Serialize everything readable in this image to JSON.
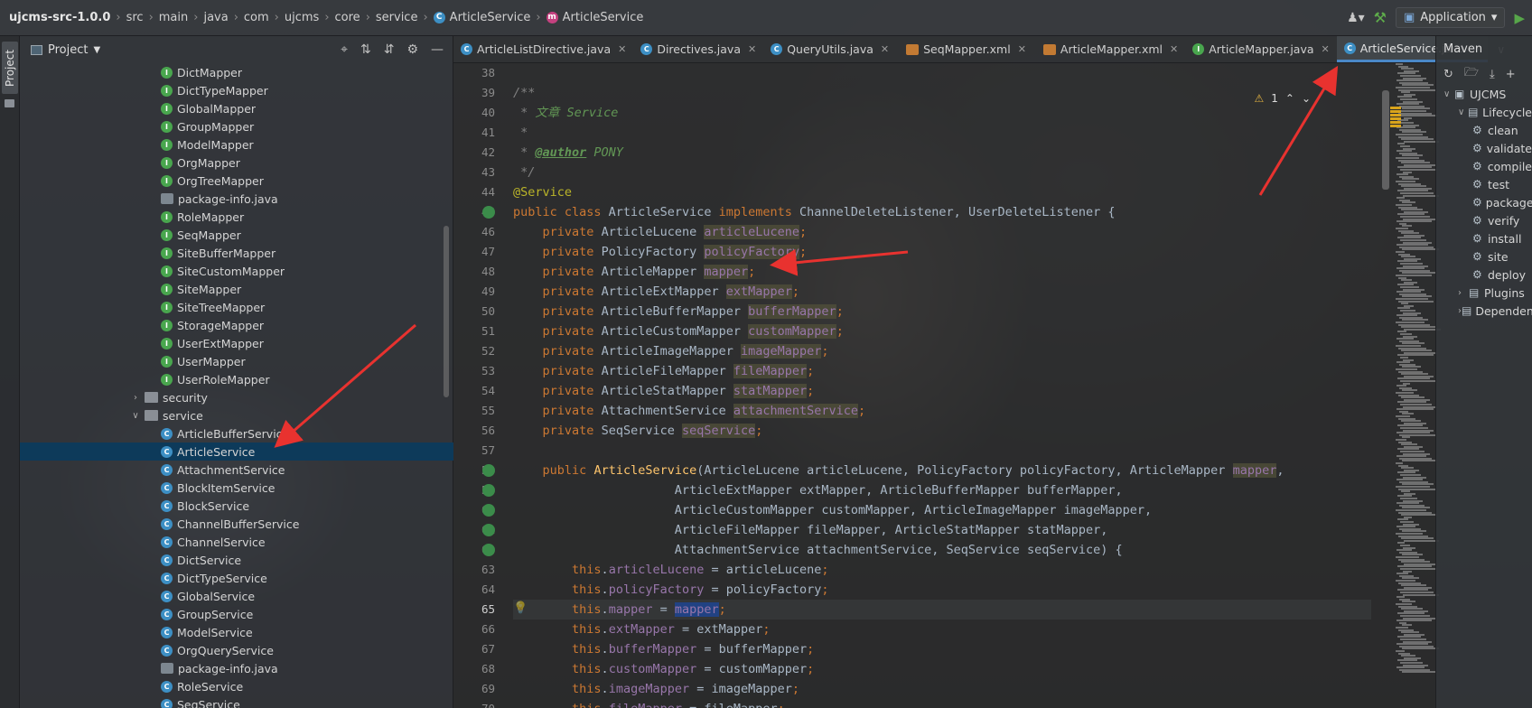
{
  "breadcrumb": [
    {
      "label": "ujcms-src-1.0.0",
      "icon": ""
    },
    {
      "label": "src",
      "icon": ""
    },
    {
      "label": "main",
      "icon": ""
    },
    {
      "label": "java",
      "icon": ""
    },
    {
      "label": "com",
      "icon": ""
    },
    {
      "label": "ujcms",
      "icon": ""
    },
    {
      "label": "core",
      "icon": ""
    },
    {
      "label": "service",
      "icon": ""
    },
    {
      "label": "ArticleService",
      "icon": "class-icon"
    },
    {
      "label": "ArticleService",
      "icon": "method-icon"
    }
  ],
  "toolbar": {
    "run_config": "Application"
  },
  "left_stripe": {
    "project_tab": "Project"
  },
  "project": {
    "title": "Project",
    "tree": [
      {
        "label": "DictMapper",
        "type": "interface",
        "indent": 156
      },
      {
        "label": "DictTypeMapper",
        "type": "interface",
        "indent": 156
      },
      {
        "label": "GlobalMapper",
        "type": "interface",
        "indent": 156
      },
      {
        "label": "GroupMapper",
        "type": "interface",
        "indent": 156
      },
      {
        "label": "ModelMapper",
        "type": "interface",
        "indent": 156
      },
      {
        "label": "OrgMapper",
        "type": "interface",
        "indent": 156
      },
      {
        "label": "OrgTreeMapper",
        "type": "interface",
        "indent": 156
      },
      {
        "label": "package-info.java",
        "type": "file",
        "indent": 156
      },
      {
        "label": "RoleMapper",
        "type": "interface",
        "indent": 156
      },
      {
        "label": "SeqMapper",
        "type": "interface",
        "indent": 156
      },
      {
        "label": "SiteBufferMapper",
        "type": "interface",
        "indent": 156
      },
      {
        "label": "SiteCustomMapper",
        "type": "interface",
        "indent": 156
      },
      {
        "label": "SiteMapper",
        "type": "interface",
        "indent": 156
      },
      {
        "label": "SiteTreeMapper",
        "type": "interface",
        "indent": 156
      },
      {
        "label": "StorageMapper",
        "type": "interface",
        "indent": 156
      },
      {
        "label": "UserExtMapper",
        "type": "interface",
        "indent": 156
      },
      {
        "label": "UserMapper",
        "type": "interface",
        "indent": 156
      },
      {
        "label": "UserRoleMapper",
        "type": "interface",
        "indent": 156
      },
      {
        "label": "security",
        "type": "folder-collapsed",
        "indent": 122
      },
      {
        "label": "service",
        "type": "folder-expanded",
        "indent": 122
      },
      {
        "label": "ArticleBufferService",
        "type": "class",
        "indent": 156
      },
      {
        "label": "ArticleService",
        "type": "class",
        "indent": 156,
        "selected": true
      },
      {
        "label": "AttachmentService",
        "type": "class",
        "indent": 156
      },
      {
        "label": "BlockItemService",
        "type": "class",
        "indent": 156
      },
      {
        "label": "BlockService",
        "type": "class",
        "indent": 156
      },
      {
        "label": "ChannelBufferService",
        "type": "class",
        "indent": 156
      },
      {
        "label": "ChannelService",
        "type": "class",
        "indent": 156
      },
      {
        "label": "DictService",
        "type": "class",
        "indent": 156
      },
      {
        "label": "DictTypeService",
        "type": "class",
        "indent": 156
      },
      {
        "label": "GlobalService",
        "type": "class",
        "indent": 156
      },
      {
        "label": "GroupService",
        "type": "class",
        "indent": 156
      },
      {
        "label": "ModelService",
        "type": "class",
        "indent": 156
      },
      {
        "label": "OrgQueryService",
        "type": "class",
        "indent": 156
      },
      {
        "label": "package-info.java",
        "type": "file",
        "indent": 156
      },
      {
        "label": "RoleService",
        "type": "class",
        "indent": 156
      },
      {
        "label": "SeqService",
        "type": "class",
        "indent": 156
      }
    ]
  },
  "editor": {
    "tabs": [
      {
        "label": "ArticleListDirective.java",
        "icon": "class",
        "active": false
      },
      {
        "label": "Directives.java",
        "icon": "class",
        "active": false
      },
      {
        "label": "QueryUtils.java",
        "icon": "class",
        "active": false
      },
      {
        "label": "SeqMapper.xml",
        "icon": "xml",
        "active": false
      },
      {
        "label": "ArticleMapper.xml",
        "icon": "xml",
        "active": false
      },
      {
        "label": "ArticleMapper.java",
        "icon": "interface",
        "active": false
      },
      {
        "label": "ArticleService.java",
        "icon": "class",
        "active": true
      }
    ],
    "warning_count": "1",
    "line_numbers": [
      "38",
      "39",
      "40",
      "41",
      "42",
      "43",
      "44",
      "45",
      "46",
      "47",
      "48",
      "49",
      "50",
      "51",
      "52",
      "53",
      "54",
      "55",
      "56",
      "57",
      "58",
      "59",
      "60",
      "61",
      "62",
      "63",
      "64",
      "65",
      "66",
      "67",
      "68",
      "69",
      "70"
    ],
    "current_line": "65",
    "code": {
      "l39": "/**",
      "l40_a": " * ",
      "l40_b": "文章 Service",
      "l41": " *",
      "l42_a": " * ",
      "l42_b": "@author",
      "l42_c": " PONY",
      "l43": " */",
      "l44": "@Service",
      "l45_kw1": "public class",
      "l45_a": " ArticleService ",
      "l45_kw2": "implements",
      "l45_b": " ChannelDeleteListener, UserDeleteListener {",
      "fields": [
        {
          "type": "ArticleLucene",
          "name": "articleLucene"
        },
        {
          "type": "PolicyFactory",
          "name": "policyFactory"
        },
        {
          "type": "ArticleMapper",
          "name": "mapper"
        },
        {
          "type": "ArticleExtMapper",
          "name": "extMapper"
        },
        {
          "type": "ArticleBufferMapper",
          "name": "bufferMapper"
        },
        {
          "type": "ArticleCustomMapper",
          "name": "customMapper"
        },
        {
          "type": "ArticleImageMapper",
          "name": "imageMapper"
        },
        {
          "type": "ArticleFileMapper",
          "name": "fileMapper"
        },
        {
          "type": "ArticleStatMapper",
          "name": "statMapper"
        },
        {
          "type": "AttachmentService",
          "name": "attachmentService"
        },
        {
          "type": "SeqService",
          "name": "seqService"
        }
      ],
      "private_kw": "private",
      "ctor_kw": "public",
      "ctor_name": "ArticleService",
      "ctor_l58_rest": "(ArticleLucene articleLucene, PolicyFactory policyFactory, ArticleMapper ",
      "ctor_l58_mapper": "mapper",
      "ctor_l58_end": ",",
      "ctor_l59": "                      ArticleExtMapper extMapper, ArticleBufferMapper bufferMapper,",
      "ctor_l60": "                      ArticleCustomMapper customMapper, ArticleImageMapper imageMapper,",
      "ctor_l61": "                      ArticleFileMapper fileMapper, ArticleStatMapper statMapper,",
      "ctor_l62": "                      AttachmentService attachmentService, SeqService seqService) {",
      "assigns": [
        {
          "field": "articleLucene",
          "value": "articleLucene"
        },
        {
          "field": "policyFactory",
          "value": "policyFactory"
        },
        {
          "field": "mapper",
          "value": "mapper"
        },
        {
          "field": "extMapper",
          "value": "extMapper"
        },
        {
          "field": "bufferMapper",
          "value": "bufferMapper"
        },
        {
          "field": "customMapper",
          "value": "customMapper"
        },
        {
          "field": "imageMapper",
          "value": "imageMapper"
        },
        {
          "field": "fileMapper",
          "value": "fileMapper"
        }
      ],
      "this_kw": "this"
    }
  },
  "maven": {
    "title": "Maven",
    "tree": [
      {
        "label": "UJCMS",
        "level": 0,
        "expanded": true,
        "icon": "maven-project-icon"
      },
      {
        "label": "Lifecycle",
        "level": 1,
        "expanded": true,
        "icon": "folder-icon"
      },
      {
        "label": "clean",
        "level": 2,
        "icon": "gear-icon"
      },
      {
        "label": "validate",
        "level": 2,
        "icon": "gear-icon"
      },
      {
        "label": "compile",
        "level": 2,
        "icon": "gear-icon"
      },
      {
        "label": "test",
        "level": 2,
        "icon": "gear-icon"
      },
      {
        "label": "package",
        "level": 2,
        "icon": "gear-icon"
      },
      {
        "label": "verify",
        "level": 2,
        "icon": "gear-icon"
      },
      {
        "label": "install",
        "level": 2,
        "icon": "gear-icon"
      },
      {
        "label": "site",
        "level": 2,
        "icon": "gear-icon"
      },
      {
        "label": "deploy",
        "level": 2,
        "icon": "gear-icon"
      },
      {
        "label": "Plugins",
        "level": 1,
        "expanded": false,
        "icon": "folder-icon"
      },
      {
        "label": "Dependencies",
        "level": 1,
        "expanded": false,
        "icon": "folder-icon"
      }
    ]
  },
  "colors": {
    "accent": "#4a88c7",
    "annotation_arrow": "#e8322f",
    "selected_row": "#0d3a5a"
  }
}
